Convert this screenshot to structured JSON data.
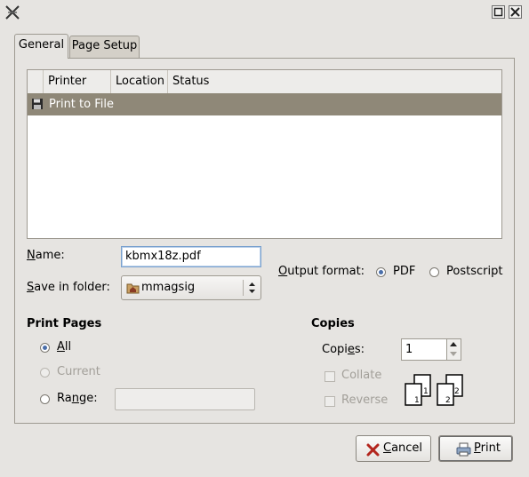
{
  "titlebar": {
    "title": ""
  },
  "tabs": [
    {
      "label": "General"
    },
    {
      "label": "Page Setup"
    }
  ],
  "printer_list": {
    "columns": [
      "Printer",
      "Location",
      "Status"
    ],
    "rows": [
      {
        "printer": "Print to File",
        "location": "",
        "status": ""
      }
    ]
  },
  "form": {
    "name_label_u": "N",
    "name_label_rest": "ame:",
    "name_value": "kbmx18z.pdf",
    "save_label_u": "S",
    "save_label_rest": "ave in folder:",
    "folder_value": "mmagsig",
    "output_label_u": "O",
    "output_label_rest": "utput format:",
    "format_pdf": "PDF",
    "format_ps": "Postscript"
  },
  "print_pages": {
    "heading": "Print Pages",
    "all_u": "A",
    "all_rest": "ll",
    "current": "Current",
    "range_pre": "Ra",
    "range_u": "n",
    "range_post": "ge:"
  },
  "copies": {
    "heading": "Copies",
    "label_pre": "Copi",
    "label_u": "e",
    "label_post": "s:",
    "value": "1",
    "collate": "Collate",
    "reverse": "Reverse"
  },
  "buttons": {
    "cancel_u": "C",
    "cancel_rest": "ancel",
    "print_u": "P",
    "print_rest": "rint"
  },
  "colors": {
    "selection": "#8f8878",
    "background": "#e6e4e1"
  }
}
